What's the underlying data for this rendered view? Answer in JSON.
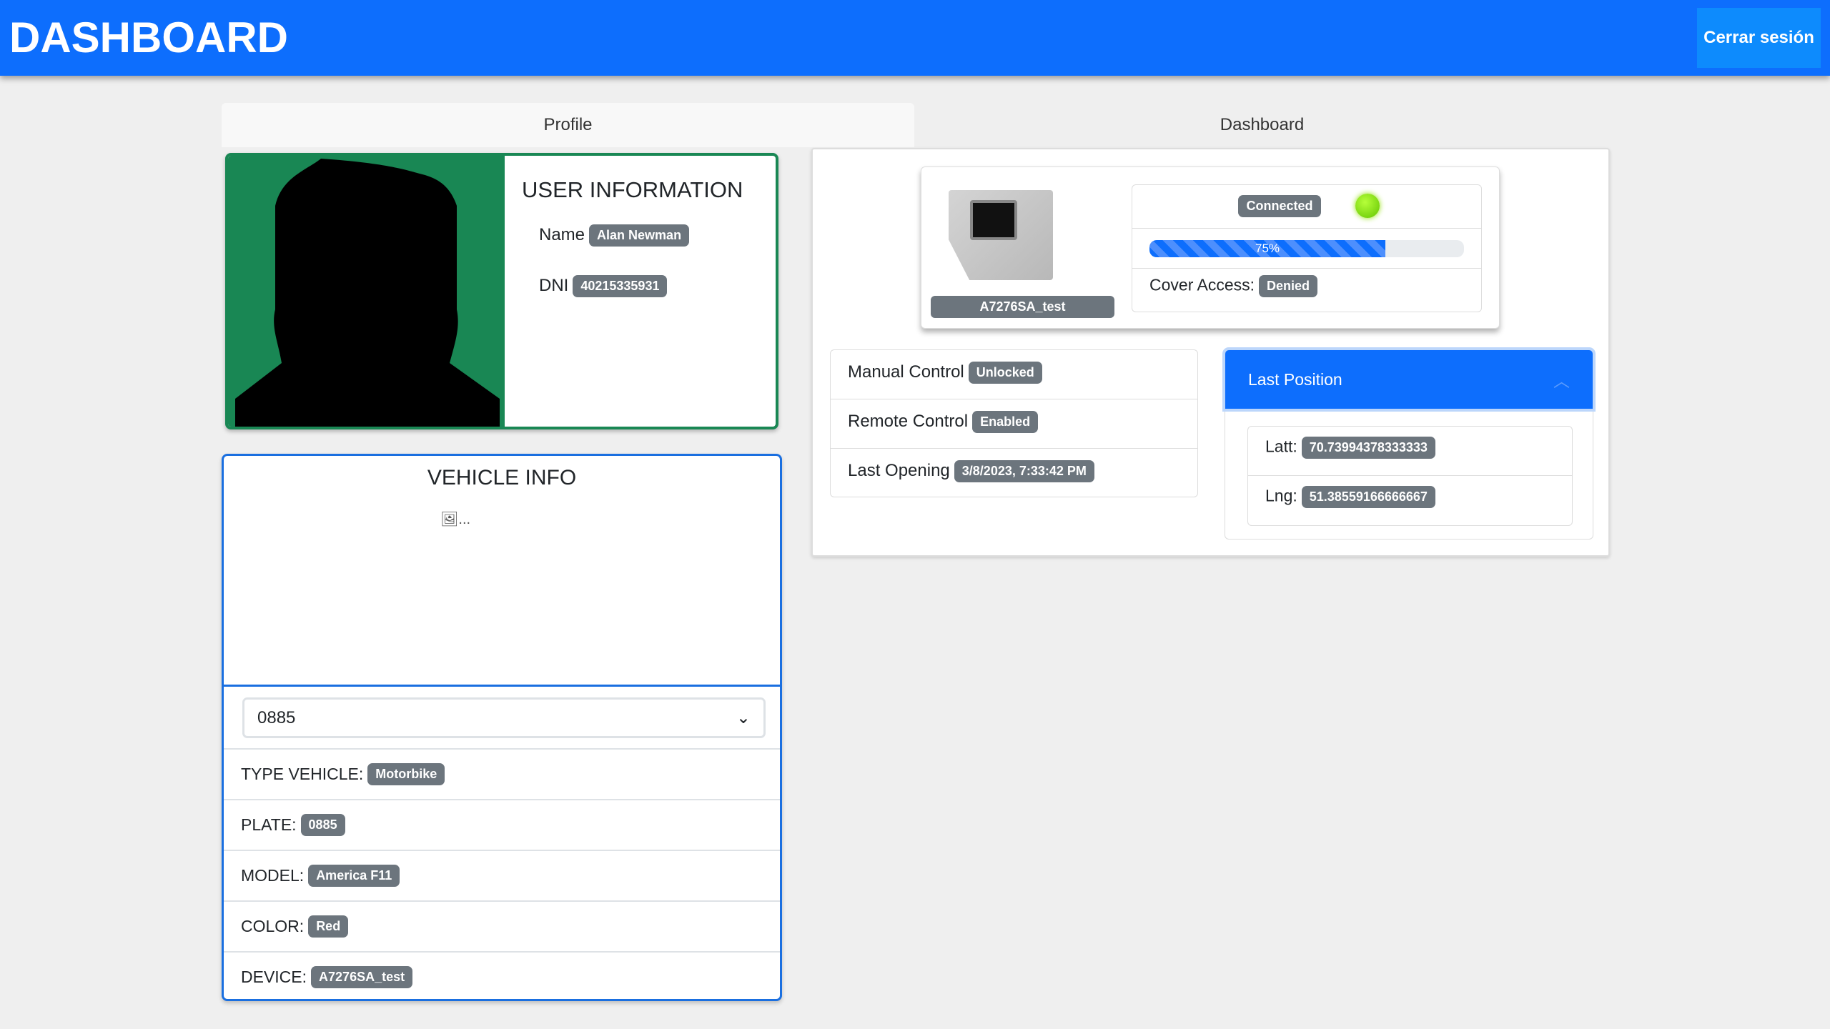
{
  "header": {
    "title": "DASHBOARD",
    "logout_label": "Cerrar sesión"
  },
  "tabs": [
    {
      "label": "Profile",
      "active": true
    },
    {
      "label": "Dashboard",
      "active": false
    }
  ],
  "user": {
    "heading": "USER INFORMATION",
    "name_label": "Name",
    "name": "Alan Newman",
    "dni_label": "DNI",
    "dni": "40215335931"
  },
  "vehicle": {
    "heading": "VEHICLE INFO",
    "image_alt": "...",
    "selected": "0885",
    "fields": [
      {
        "label": "TYPE VEHICLE:",
        "value": "Motorbike"
      },
      {
        "label": "PLATE:",
        "value": "0885"
      },
      {
        "label": "MODEL:",
        "value": "America F11"
      },
      {
        "label": "COLOR:",
        "value": "Red"
      },
      {
        "label": "DEVICE:",
        "value": "A7276SA_test"
      }
    ]
  },
  "device": {
    "name": "A7276SA_test",
    "connection": "Connected",
    "led_color": "#7ee000",
    "progress_percent": 75,
    "progress_label": "75%",
    "cover_label": "Cover Access:",
    "cover_value": "Denied"
  },
  "controls": [
    {
      "label": "Manual Control",
      "value": "Unlocked"
    },
    {
      "label": "Remote Control",
      "value": "Enabled"
    },
    {
      "label": "Last Opening",
      "value": "3/8/2023, 7:33:42 PM"
    }
  ],
  "position": {
    "title": "Last Position",
    "lat_label": "Latt:",
    "lat": "70.73994378333333",
    "lng_label": "Lng:",
    "lng": "51.38559166666667"
  },
  "colors": {
    "primary": "#0d6efd",
    "success": "#198754",
    "badge": "#6c757d"
  }
}
